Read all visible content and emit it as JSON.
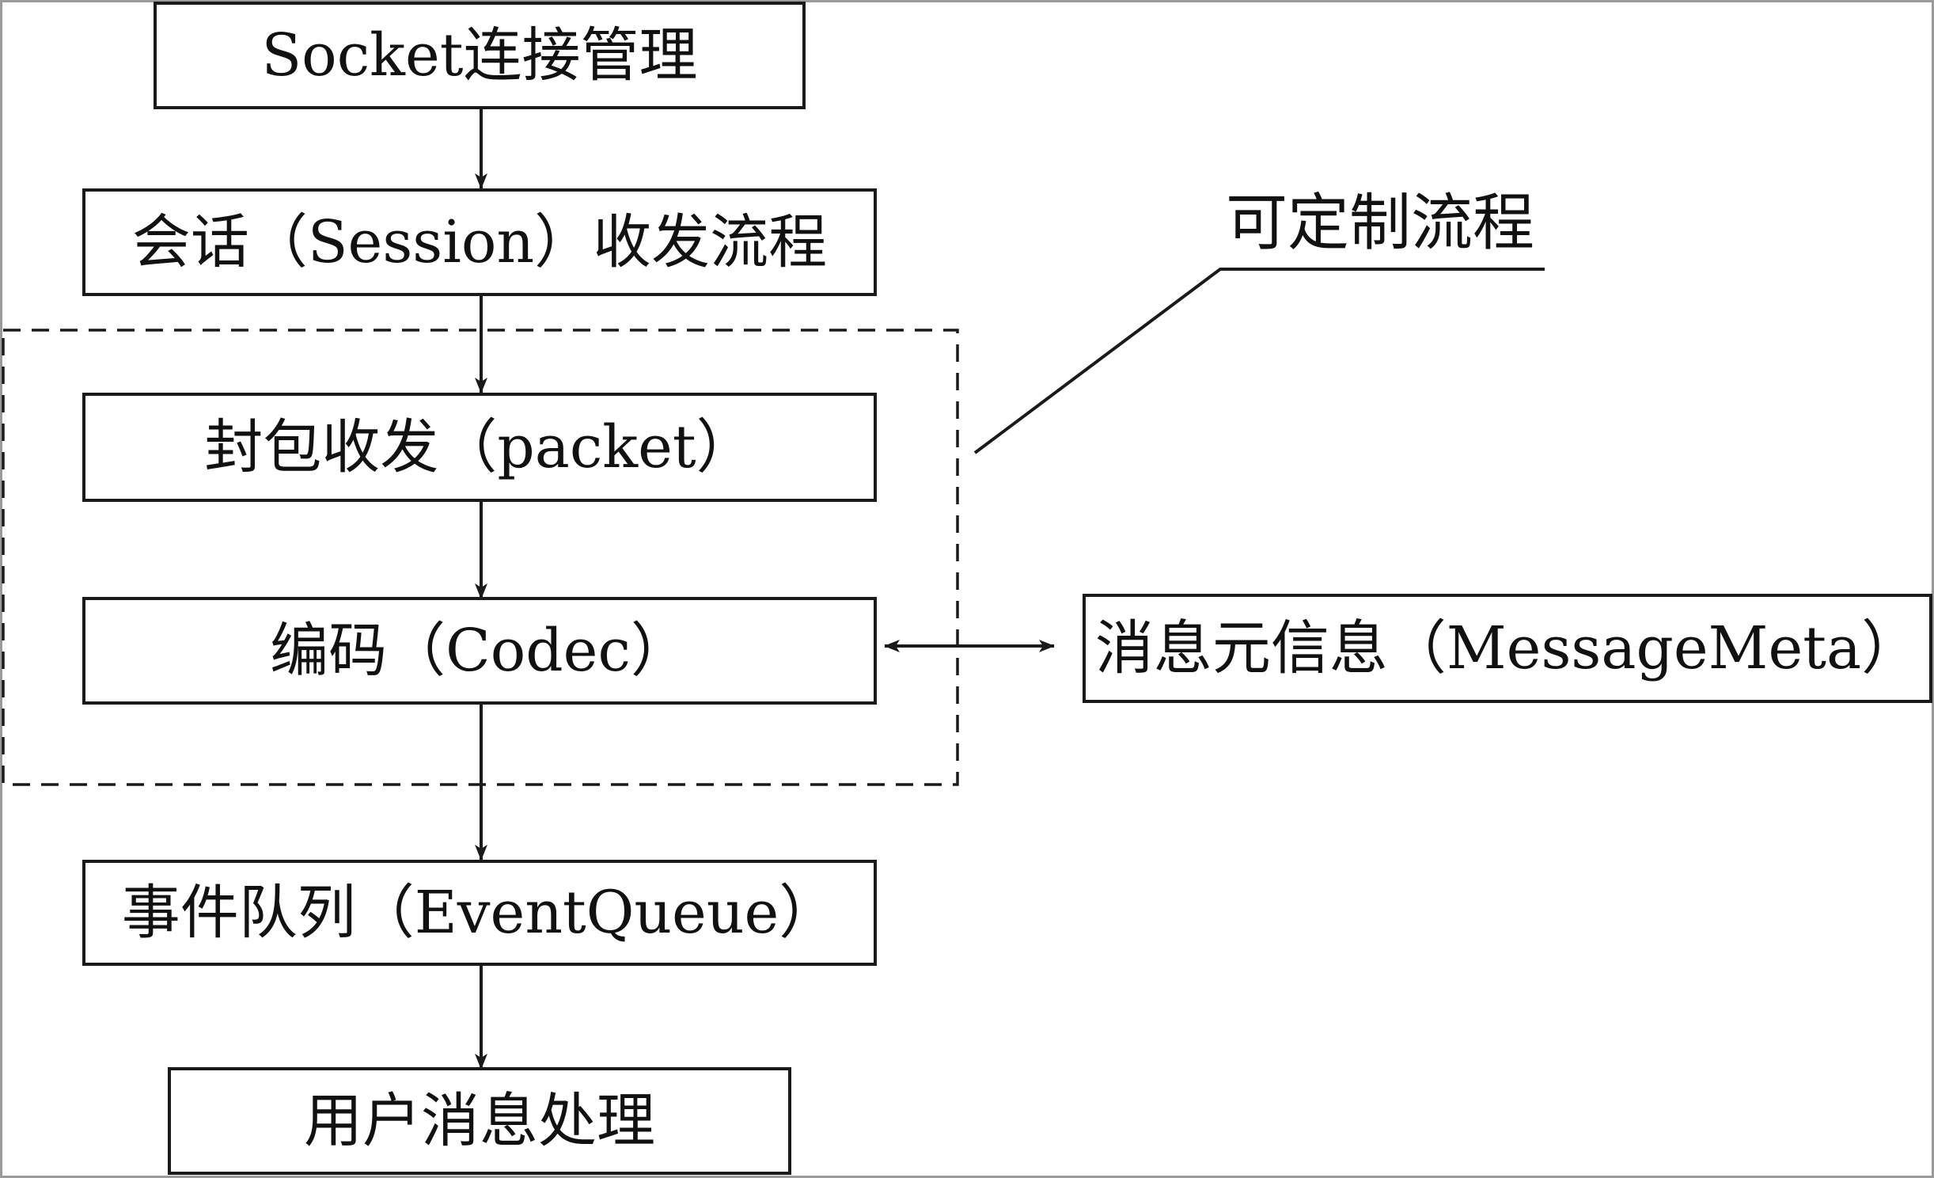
{
  "diagram": {
    "nodes": {
      "socket": {
        "label": "Socket连接管理"
      },
      "session": {
        "label": "会话（Session）收发流程"
      },
      "packet": {
        "label": "封包收发（packet）"
      },
      "codec": {
        "label": "编码（Codec）"
      },
      "meta": {
        "label": "消息元信息（MessageMeta）"
      },
      "eventqueue": {
        "label": "事件队列（EventQueue）"
      },
      "user": {
        "label": "用户消息处理"
      }
    },
    "annotation": {
      "label": "可定制流程"
    },
    "edges": [
      {
        "from": "socket",
        "to": "session",
        "direction": "forward"
      },
      {
        "from": "session",
        "to": "packet",
        "direction": "forward"
      },
      {
        "from": "packet",
        "to": "codec",
        "direction": "forward"
      },
      {
        "from": "codec",
        "to": "eventqueue",
        "direction": "forward"
      },
      {
        "from": "eventqueue",
        "to": "user",
        "direction": "forward"
      },
      {
        "from": "codec",
        "to": "meta",
        "direction": "both"
      }
    ],
    "colors": {
      "line": "#1a1a1a",
      "text": "#111111",
      "background": "#ffffff"
    }
  }
}
